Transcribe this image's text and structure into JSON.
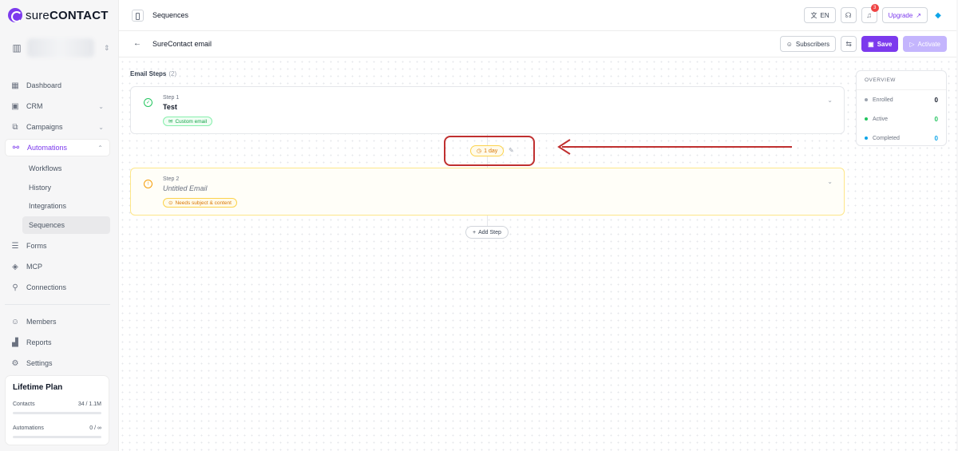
{
  "brand": {
    "logo_text_a": "sure",
    "logo_text_b": "CONTACT",
    "accent": "#7c3aed"
  },
  "sidebar": {
    "items": [
      {
        "label": "Dashboard",
        "icon": "dashboard-icon"
      },
      {
        "label": "CRM",
        "icon": "crm-icon"
      },
      {
        "label": "Campaigns",
        "icon": "campaigns-icon"
      },
      {
        "label": "Automations",
        "icon": "automations-icon"
      }
    ],
    "subitems": [
      "Workflows",
      "History",
      "Integrations",
      "Sequences"
    ],
    "items2": [
      {
        "label": "Forms",
        "icon": "forms-icon"
      },
      {
        "label": "MCP",
        "icon": "mcp-icon"
      },
      {
        "label": "Connections",
        "icon": "connections-icon"
      }
    ],
    "items3": [
      {
        "label": "Members",
        "icon": "members-icon"
      },
      {
        "label": "Reports",
        "icon": "reports-icon"
      },
      {
        "label": "Settings",
        "icon": "settings-icon"
      }
    ],
    "plan": {
      "title": "Lifetime Plan",
      "contacts_label": "Contacts",
      "contacts_value": "34 / 1.1M",
      "automations_label": "Automations",
      "automations_value": "0 / ∞"
    }
  },
  "topbar": {
    "title": "Sequences",
    "lang": "EN",
    "notifications": "3",
    "upgrade": "Upgrade"
  },
  "subbar": {
    "title": "SureContact email",
    "subscribers": "Subscribers",
    "save": "Save",
    "activate": "Activate"
  },
  "steps": {
    "heading": "Email Steps",
    "count": "(2)",
    "items": [
      {
        "step_label": "Step 1",
        "name": "Test",
        "tag": "Custom email"
      },
      {
        "step_label": "Step 2",
        "name": "Untitled Email",
        "tag": "Needs subject & content"
      }
    ],
    "delay": "1 day",
    "add_step": "Add Step"
  },
  "overview": {
    "title": "OVERVIEW",
    "rows": [
      {
        "label": "Enrolled",
        "value": "0",
        "color": "#9ca3af"
      },
      {
        "label": "Active",
        "value": "0",
        "color": "#22c55e"
      },
      {
        "label": "Completed",
        "value": "0",
        "color": "#0ea5e9"
      }
    ]
  }
}
